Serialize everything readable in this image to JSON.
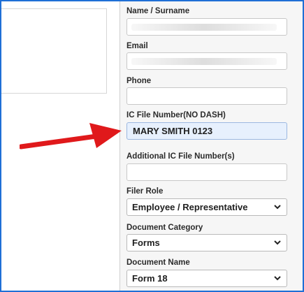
{
  "form": {
    "name": {
      "label": "Name / Surname",
      "value": ""
    },
    "email": {
      "label": "Email",
      "value": ""
    },
    "phone": {
      "label": "Phone",
      "value": ""
    },
    "ic_file": {
      "label": "IC File Number(NO DASH)",
      "value": "MARY SMITH 0123"
    },
    "additional_ic": {
      "label": "Additional IC File Number(s)",
      "value": ""
    },
    "filer_role": {
      "label": "Filer Role",
      "selected": "Employee / Representative"
    },
    "doc_category": {
      "label": "Document Category",
      "selected": "Forms"
    },
    "doc_name": {
      "label": "Document Name",
      "selected": "Form 18"
    }
  },
  "annotation": {
    "arrow_color": "#e0191b"
  },
  "colors": {
    "frame_border": "#1f6fd6",
    "highlight_field": "#e7f0fd"
  }
}
